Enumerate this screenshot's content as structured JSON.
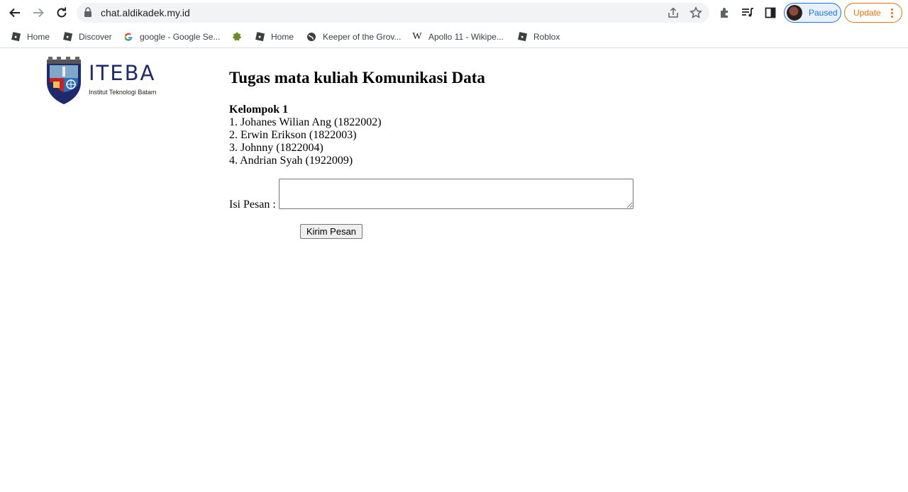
{
  "browser": {
    "url": "chat.aldikadek.my.id",
    "profile_label": "Paused",
    "update_label": "Update",
    "bookmarks": [
      {
        "label": "Home",
        "icon": "roblox-icon"
      },
      {
        "label": "Discover",
        "icon": "roblox-icon"
      },
      {
        "label": "google - Google Se...",
        "icon": "google-icon"
      },
      {
        "label": "",
        "icon": "green-leaf-icon"
      },
      {
        "label": "Home",
        "icon": "roblox-icon"
      },
      {
        "label": "Keeper of the Grov...",
        "icon": "globe-icon"
      },
      {
        "label": "Apollo 11 - Wikipe...",
        "icon": "wikipedia-icon"
      },
      {
        "label": "Roblox",
        "icon": "roblox-icon"
      }
    ]
  },
  "logo": {
    "brand": "ITEBA",
    "subtitle": "Institut Teknologi Batam"
  },
  "page": {
    "title": "Tugas mata kuliah Komunikasi Data",
    "group": "Kelompok 1",
    "members": [
      "1. Johanes Wilian Ang (1822002)",
      "2. Erwin Erikson (1822003)",
      "3. Johnny (1822004)",
      "4. Andrian Syah (1922009)"
    ]
  },
  "form": {
    "label": "Isi Pesan :",
    "textarea_value": "",
    "submit_label": "Kirim Pesan"
  },
  "colors": {
    "brand_navy": "#1f2a6d",
    "profile_blue": "#1a73e8",
    "update_orange": "#e8710a"
  }
}
